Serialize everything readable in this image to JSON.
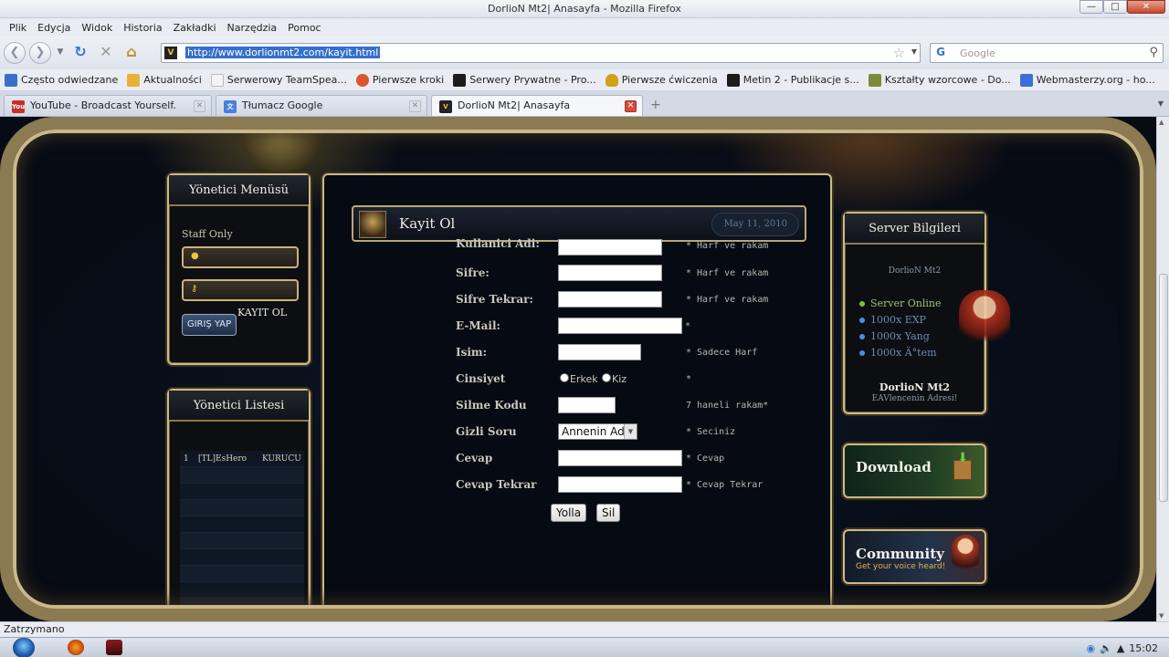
{
  "window": {
    "title": "DorlioN Mt2| Anasayfa - Mozilla Firefox",
    "min": "—",
    "max": "□",
    "close": "✕"
  },
  "menu": [
    "Plik",
    "Edycja",
    "Widok",
    "Historia",
    "Zakładki",
    "Narzędzia",
    "Pomoc"
  ],
  "nav": {
    "url": "http://www.dorlionmt2.com/kayit.html",
    "search_placeholder": "Google"
  },
  "bookmarks": [
    {
      "label": "Często odwiedzane",
      "color": "#3b6fc9"
    },
    {
      "label": "Aktualności",
      "color": "#e7b23a"
    },
    {
      "label": "Serwerowy TeamSpea...",
      "color": "#f4f4f4"
    },
    {
      "label": "Pierwsze kroki",
      "color": "#d9572b"
    },
    {
      "label": "Serwery Prywatne - Pro...",
      "color": "#1c1c1c"
    },
    {
      "label": "Pierwsze ćwiczenia",
      "color": "#d4a017"
    },
    {
      "label": "Metin 2 - Publikacje s...",
      "color": "#1c1c1c"
    },
    {
      "label": "Kształty wzorcowe - Do...",
      "color": "#7a8c3a"
    },
    {
      "label": "Webmasterzy.org - ho...",
      "color": "#3a6fd4"
    }
  ],
  "tabs": [
    {
      "label": "YouTube - Broadcast Yourself.",
      "icon_color": "#c4302b"
    },
    {
      "label": "Tłumacz Google",
      "icon_color": "#4a7fe0"
    },
    {
      "label": "DorlioN Mt2| Anasayfa",
      "icon_color": "#222222"
    }
  ],
  "left": {
    "admin_menu_title": "Yönetici Menüsü",
    "staff_label": "Staff Only",
    "login_button": "GIRIŞ YAP",
    "register_link": "KAYIT OL",
    "admin_list_title": "Yönetici Listesi",
    "admins": [
      {
        "rank": "1",
        "name": "[TL]EsHero",
        "role": "KURUCU"
      }
    ]
  },
  "post": {
    "title": "Kayit Ol",
    "date": "May 11, 2010"
  },
  "form": {
    "username": {
      "label": "Kullanici Adi:",
      "hint": "* Harf ve rakam"
    },
    "password": {
      "label": "Sifre:",
      "hint": "* Harf ve rakam"
    },
    "password_repeat": {
      "label": "Sifre Tekrar:",
      "hint": "* Harf ve rakam"
    },
    "email": {
      "label": "E-Mail:",
      "hint": "*"
    },
    "name": {
      "label": "Isim:",
      "hint": "* Sadece Harf"
    },
    "gender": {
      "label": "Cinsiyet",
      "male": "Erkek",
      "female": "Kiz",
      "hint": "*"
    },
    "delete_code": {
      "label": "Silme Kodu",
      "hint": "7 haneli rakam*"
    },
    "secret_question": {
      "label": "Gizli Soru",
      "value": "Annenin Adi",
      "hint": "* Seciniz"
    },
    "answer": {
      "label": "Cevap",
      "hint": "* Cevap"
    },
    "answer_repeat": {
      "label": "Cevap Tekrar",
      "hint": "* Cevap Tekrar"
    },
    "submit": "Yolla",
    "reset": "Sil"
  },
  "right": {
    "server_title": "Server Bilgileri",
    "server_name": "DorlioN Mt2",
    "items": [
      {
        "label": "Server Online",
        "color": "#7fbf3a",
        "text_color": "#9fc46a"
      },
      {
        "label": "1000x EXP",
        "color": "#4a8fe0",
        "text_color": "#6d8bb0"
      },
      {
        "label": "1000x Yang",
        "color": "#4a8fe0",
        "text_color": "#6d8bb0"
      },
      {
        "label": "1000x Ä°tem",
        "color": "#4a8fe0",
        "text_color": "#6d8bb0"
      }
    ],
    "footer_name": "DorlioN Mt2",
    "footer_sub": "EAVlencenin Adresi!",
    "download": "Download",
    "community": "Community",
    "community_sub": "Get your voice heard!"
  },
  "status": "Zatrzymano",
  "clock": "15:02"
}
